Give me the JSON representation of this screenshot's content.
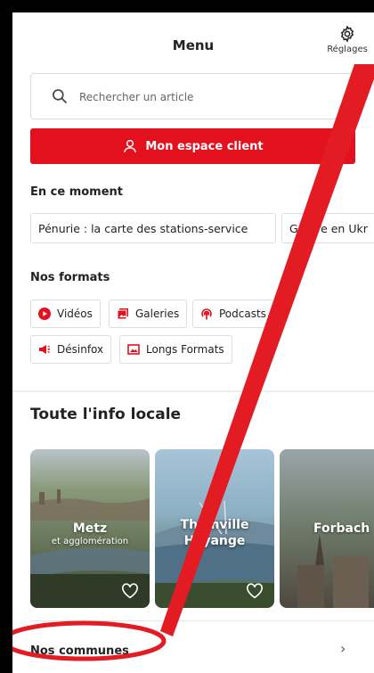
{
  "header": {
    "title": "Menu",
    "settings_label": "Réglages"
  },
  "search": {
    "placeholder": "Rechercher un article"
  },
  "client_button": {
    "label": "Mon espace client"
  },
  "moment": {
    "title": "En ce moment",
    "chips": [
      "Pénurie : la carte des stations-service",
      "Guerre en Ukr"
    ]
  },
  "formats": {
    "title": "Nos formats",
    "items": [
      {
        "label": "Vidéos",
        "icon": "play-icon"
      },
      {
        "label": "Galeries",
        "icon": "gallery-icon"
      },
      {
        "label": "Podcasts",
        "icon": "podcast-icon"
      },
      {
        "label": "Désinfox",
        "icon": "megaphone-icon"
      },
      {
        "label": "Longs Formats",
        "icon": "long-format-icon"
      }
    ]
  },
  "local": {
    "title": "Toute l'info locale",
    "cards": [
      {
        "name": "Metz",
        "subtitle": "et agglomération"
      },
      {
        "name": "Thionville Hayange",
        "subtitle": ""
      },
      {
        "name": "Forbach",
        "subtitle": ""
      }
    ]
  },
  "communes": {
    "label": "Nos communes"
  },
  "colors": {
    "accent": "#e3101e",
    "annotation": "#e31b23"
  }
}
